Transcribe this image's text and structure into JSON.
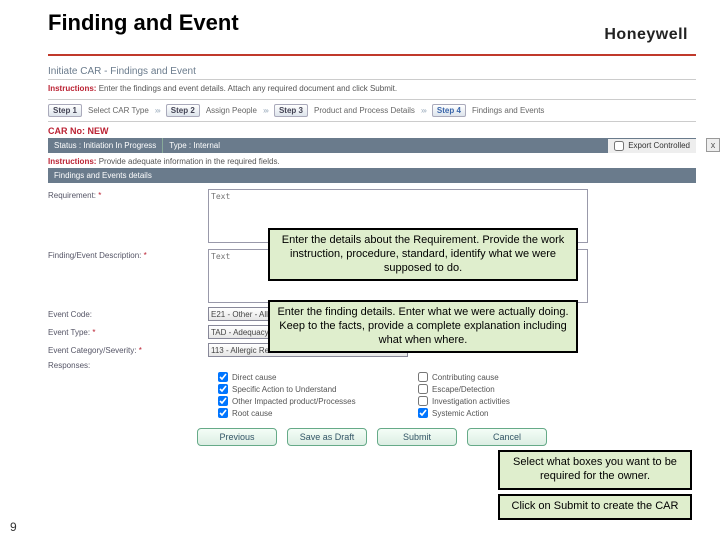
{
  "slide": {
    "title": "Finding and Event",
    "brand": "Honeywell",
    "page_number": "9"
  },
  "app": {
    "crumb": "Initiate CAR - Findings and Event",
    "instructions_label": "Instructions:",
    "instructions_text": "Enter the findings and event details. Attach any required document and click Submit.",
    "steps": [
      {
        "badge": "Step 1",
        "text": "Select CAR Type"
      },
      {
        "badge": "Step 2",
        "text": "Assign People"
      },
      {
        "badge": "Step 3",
        "text": "Product and Process Details"
      },
      {
        "badge": "Step 4",
        "text": "Findings and Events"
      }
    ],
    "car_no": "CAR No: NEW",
    "status_label": "Status :",
    "status_value": "Initiation In Progress",
    "type_label": "Type :",
    "type_value": "Internal",
    "export_label": "Export Controlled",
    "close_x": "x",
    "sub_instr_label": "Instructions:",
    "sub_instr_text": "Provide adequate information in the required fields.",
    "section_title": "Findings and Events details",
    "fields": {
      "requirement_label": "Requirement:",
      "requirement_placeholder": "Text",
      "finding_label": "Finding/Event Description:",
      "finding_placeholder": "Text",
      "event_code_label": "Event Code:",
      "event_code_value": "E21 - Other - All",
      "event_type_label": "Event Type:",
      "event_type_value": "TAD - Adequacy - Part Quality",
      "event_cat_label": "Event Category/Severity:",
      "event_cat_value": "113 - Allergic Reaction",
      "responses_label": "Responses:"
    },
    "responses": {
      "col1": [
        "Direct cause",
        "Specific Action to Understand",
        "Other Impacted product/Processes",
        "Root cause"
      ],
      "col2": [
        "Contributing cause",
        "Escape/Detection",
        "Investigation activities",
        "Systemic Action"
      ]
    },
    "buttons": {
      "previous": "Previous",
      "draft": "Save as Draft",
      "submit": "Submit",
      "cancel": "Cancel"
    }
  },
  "callouts": {
    "c1": "Enter the details about the Requirement. Provide the work instruction, procedure, standard, identify what we were supposed to do.",
    "c2": "Enter the finding details. Enter what we were actually doing. Keep to the facts, provide a complete explanation including what when where.",
    "c3": "Select what boxes you want to be required for the owner.",
    "c4": "Click on Submit to create the CAR"
  }
}
